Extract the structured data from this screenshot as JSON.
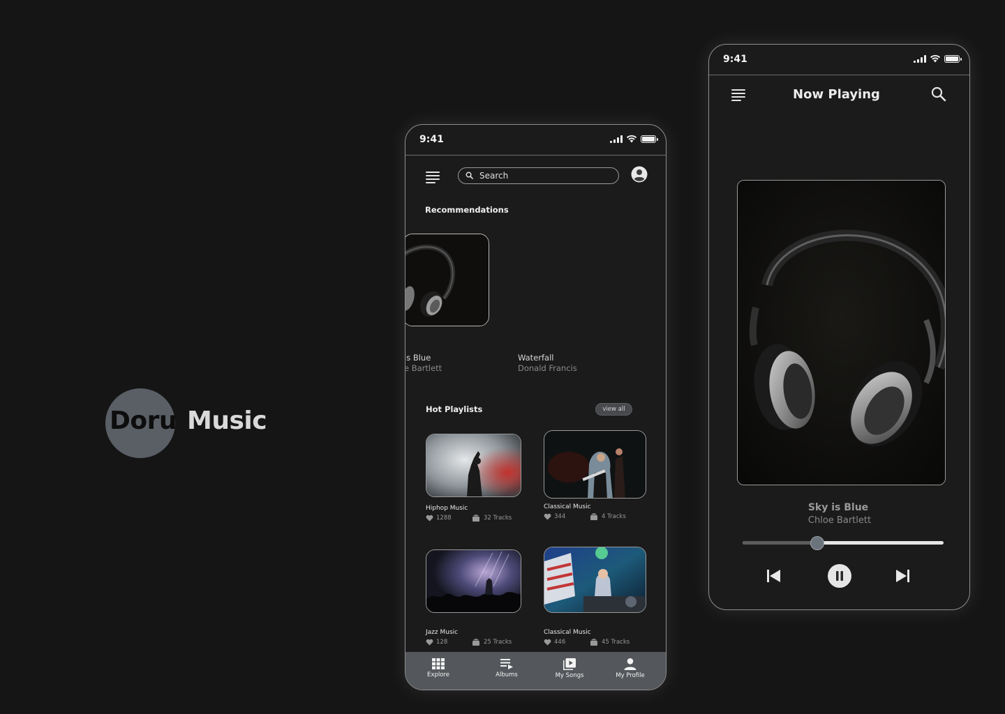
{
  "brand": {
    "word1": "Doru",
    "word2": "Music",
    "circle_color": "#5a5f66"
  },
  "explore_screen": {
    "status_time": "9:41",
    "search": {
      "placeholder": "Search",
      "value": ""
    },
    "recommendations": {
      "title": "Recommendations",
      "items": [
        {
          "song": "is Blue",
          "artist": "e Bartlett"
        },
        {
          "song": "Waterfall",
          "artist": "Donald Francis"
        }
      ]
    },
    "hot_playlists": {
      "title": "Hot Playlists",
      "view_all_label": "view all",
      "items": [
        {
          "name": "Hiphop Music",
          "likes": "1288",
          "tracks": "32 Tracks"
        },
        {
          "name": "Classical Music",
          "likes": "344",
          "tracks": "4 Tracks"
        },
        {
          "name": "Jazz Music",
          "likes": "128",
          "tracks": "25 Tracks"
        },
        {
          "name": "Classical Music",
          "likes": "446",
          "tracks": "45 Tracks"
        }
      ]
    },
    "bottom_nav": [
      {
        "label": "Explore",
        "icon": "grid-icon"
      },
      {
        "label": "Albums",
        "icon": "playlist-icon"
      },
      {
        "label": "My Songs",
        "icon": "video-library-icon"
      },
      {
        "label": "My Profile",
        "icon": "person-icon"
      }
    ],
    "nav_color": "#54575b"
  },
  "now_playing_screen": {
    "status_time": "9:41",
    "title": "Now Playing",
    "song": "Sky is Blue",
    "artist": "Chloe Bartlett",
    "progress": 0.37,
    "controls": [
      "skip-previous-icon",
      "pause-icon",
      "skip-next-icon"
    ]
  }
}
